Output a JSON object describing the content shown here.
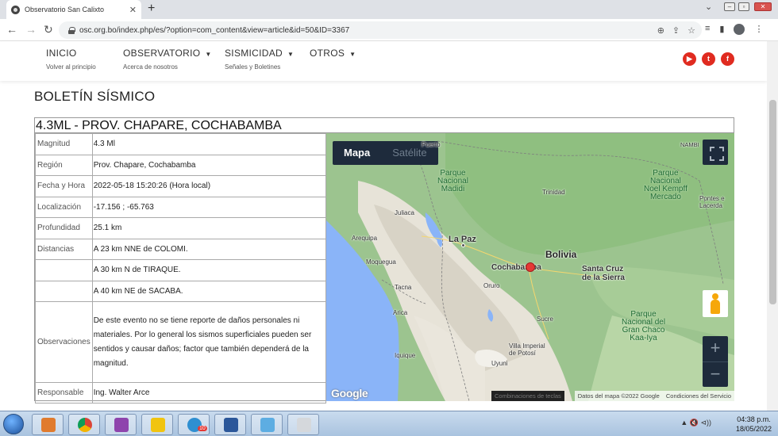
{
  "browser": {
    "tab_title": "Observatorio San Calixto",
    "tab_close": "✕",
    "new_tab": "+",
    "url": "osc.org.bo/index.php/es/?option=com_content&view=article&id=50&ID=3367"
  },
  "nav": {
    "items": [
      {
        "label": "INICIO",
        "sub": "Volver al principio"
      },
      {
        "label": "OBSERVATORIO",
        "sub": "Acerca de nosotros"
      },
      {
        "label": "SISMICIDAD",
        "sub": "Señales y Boletines"
      },
      {
        "label": "OTROS",
        "sub": ""
      }
    ],
    "social": {
      "youtube": "▶",
      "twitter": "t",
      "facebook": "f"
    }
  },
  "page": {
    "title": "BOLETÍN SÍSMICO",
    "report_title": "4.3ML - PROV. CHAPARE, COCHABAMBA"
  },
  "report": {
    "magnitud_label": "Magnitud",
    "magnitud": "4.3 Ml",
    "region_label": "Región",
    "region": "Prov. Chapare, Cochabamba",
    "fecha_label": "Fecha y Hora",
    "fecha": "2022-05-18 15:20:26 (Hora local)",
    "loc_label": "Localización",
    "loc": "-17.156 ; -65.763",
    "prof_label": "Profundidad",
    "prof": "25.1 km",
    "dist_label": "Distancias",
    "dist1": "A 23 km NNE de COLOMI.",
    "dist2": "A 30 km N de TIRAQUE.",
    "dist3": "A 40 km NE de SACABA.",
    "obs_label": "Observaciones",
    "obs": "De este evento no se tiene reporte de daños personales ni materiales. Por lo general los sismos superficiales pueden ser sentidos y causar daños; factor que también dependerá de la magnitud.",
    "resp_label": "Responsable",
    "resp": "Ing. Walter Arce"
  },
  "map": {
    "type_map": "Mapa",
    "type_sat": "Satélite",
    "zoom_in": "+",
    "zoom_out": "−",
    "labels": {
      "puerto": "Puerto",
      "nambi": "NAMBI",
      "madidi": "Parque\nNacional\nMadidi",
      "kempff": "Parque\nNacional\nNoel Kempff\nMercado",
      "pontes": "Pontes e\nLacerda",
      "trinidad": "Trinidad",
      "juliaca": "Juliaca",
      "lapaz": "La Paz",
      "arequipa": "Arequipa",
      "moquegua": "Moquegua",
      "bolivia": "Bolivia",
      "cochabamba": "Cochabamba",
      "santacruz": "Santa Cruz\nde la Sierra",
      "tacna": "Tacna",
      "oruro": "Oruro",
      "arica": "Arica",
      "sucre": "Sucre",
      "kaaiya": "Parque\nNacional del\nGran Chaco\nKaa-Iya",
      "iquique": "Iquique",
      "villa": "Villa Imperial\nde Potosí",
      "uyuni": "Uyuni"
    },
    "google": "Google",
    "shortcuts": "Combinaciones de teclas",
    "attribution": "Datos del mapa ©2022 Google",
    "terms": "Condiciones del Servicio"
  },
  "taskbar": {
    "time": "04:38 p.m.",
    "date": "18/05/2022",
    "tray": "▲ 🔇 ⊲))",
    "apps": [
      "media-player",
      "chrome",
      "ic-app",
      "file-explorer",
      "telegram",
      "word",
      "notes",
      "paint"
    ],
    "telegram_badge": "10"
  },
  "colors": {
    "accent_red": "#e02b20",
    "map_dark": "#1e2b3c",
    "quake": "#e53935"
  }
}
